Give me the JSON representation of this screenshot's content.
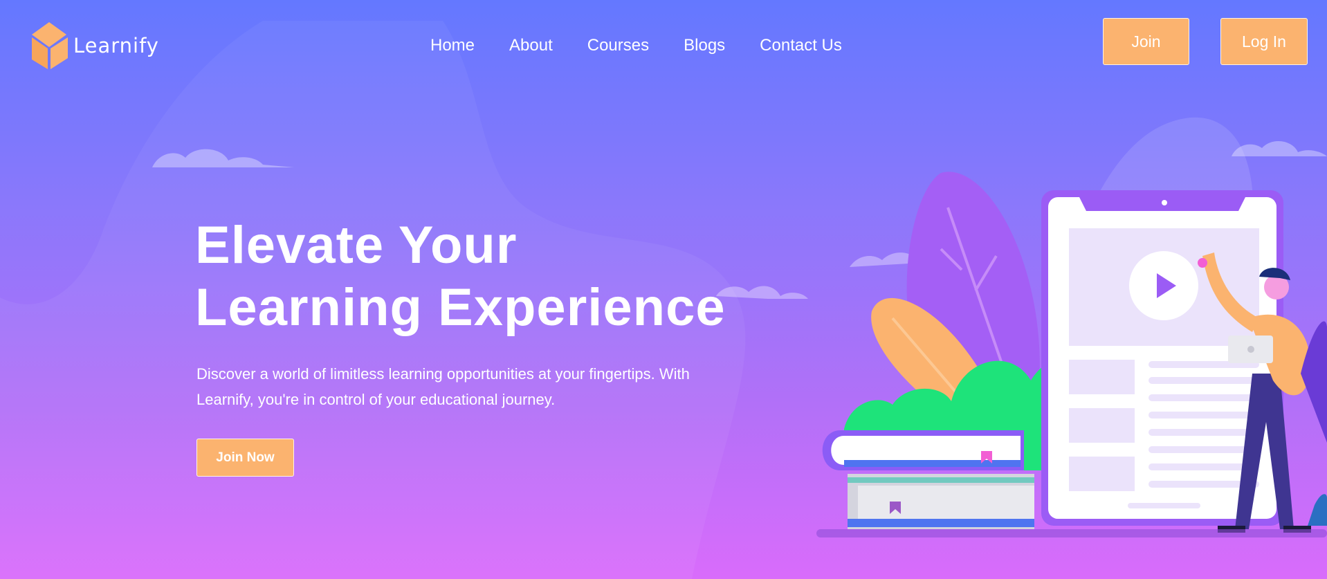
{
  "brand": {
    "name": "Learnify"
  },
  "nav": {
    "items": [
      "Home",
      "About",
      "Courses",
      "Blogs",
      "Contact Us"
    ]
  },
  "header": {
    "join_label": "Join",
    "login_label": "Log In"
  },
  "hero": {
    "title_line1": "Elevate Your",
    "title_line2": "Learning Experience",
    "description_line1": "Discover a world of limitless learning opportunities at your fingertips. With",
    "description_line2": "Learnify, you're in control of your educational journey.",
    "cta_label": "Join Now"
  },
  "colors": {
    "accent": "#fbb36f",
    "gradient_top": "#6478ff",
    "gradient_bottom": "#d96cfb",
    "text": "#ffffff"
  },
  "icons": [
    "logo-cube-icon",
    "play-icon",
    "bookmark-icon"
  ]
}
